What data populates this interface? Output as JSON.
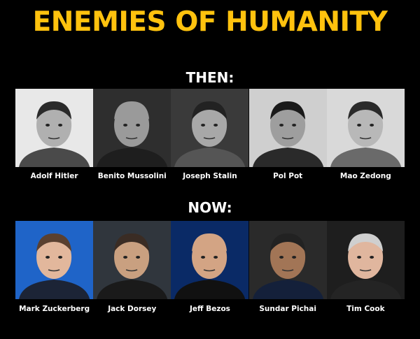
{
  "title": "ENEMIES OF HUMANITY",
  "then": {
    "heading": "THEN:",
    "people": [
      {
        "name": "Adolf Hitler",
        "bg": "#e8e8e8",
        "skin": "#b0b0b0",
        "hair": "#2a2a2a",
        "suit": "#4a4a4a"
      },
      {
        "name": "Benito Mussolini",
        "bg": "#2e2e2e",
        "skin": "#9a9a9a",
        "hair": "#9a9a9a",
        "suit": "#1e1e1e"
      },
      {
        "name": "Joseph Stalin",
        "bg": "#3a3a3a",
        "skin": "#a8a8a8",
        "hair": "#222222",
        "suit": "#555555"
      },
      {
        "name": "Pol Pot",
        "bg": "#cfcfcf",
        "skin": "#9e9e9e",
        "hair": "#1a1a1a",
        "suit": "#2a2a2a"
      },
      {
        "name": "Mao Zedong",
        "bg": "#d9d9d9",
        "skin": "#b8b8b8",
        "hair": "#2a2a2a",
        "suit": "#6a6a6a"
      }
    ]
  },
  "now": {
    "heading": "NOW:",
    "people": [
      {
        "name": "Mark Zuckerberg",
        "bg": "#1f64c8",
        "skin": "#e2b79c",
        "hair": "#5a4030",
        "suit": "#1c2436"
      },
      {
        "name": "Jack Dorsey",
        "bg": "#30363d",
        "skin": "#c9a080",
        "hair": "#3a2c24",
        "suit": "#1a1a1a"
      },
      {
        "name": "Jeff Bezos",
        "bg": "#0a2a66",
        "skin": "#d3a484",
        "hair": "#d3a484",
        "suit": "#111111"
      },
      {
        "name": "Sundar Pichai",
        "bg": "#2a2a2a",
        "skin": "#a27556",
        "hair": "#222222",
        "suit": "#14203a"
      },
      {
        "name": "Tim Cook",
        "bg": "#1e1e1e",
        "skin": "#e0b69e",
        "hair": "#cfcfcf",
        "suit": "#242424"
      }
    ]
  }
}
